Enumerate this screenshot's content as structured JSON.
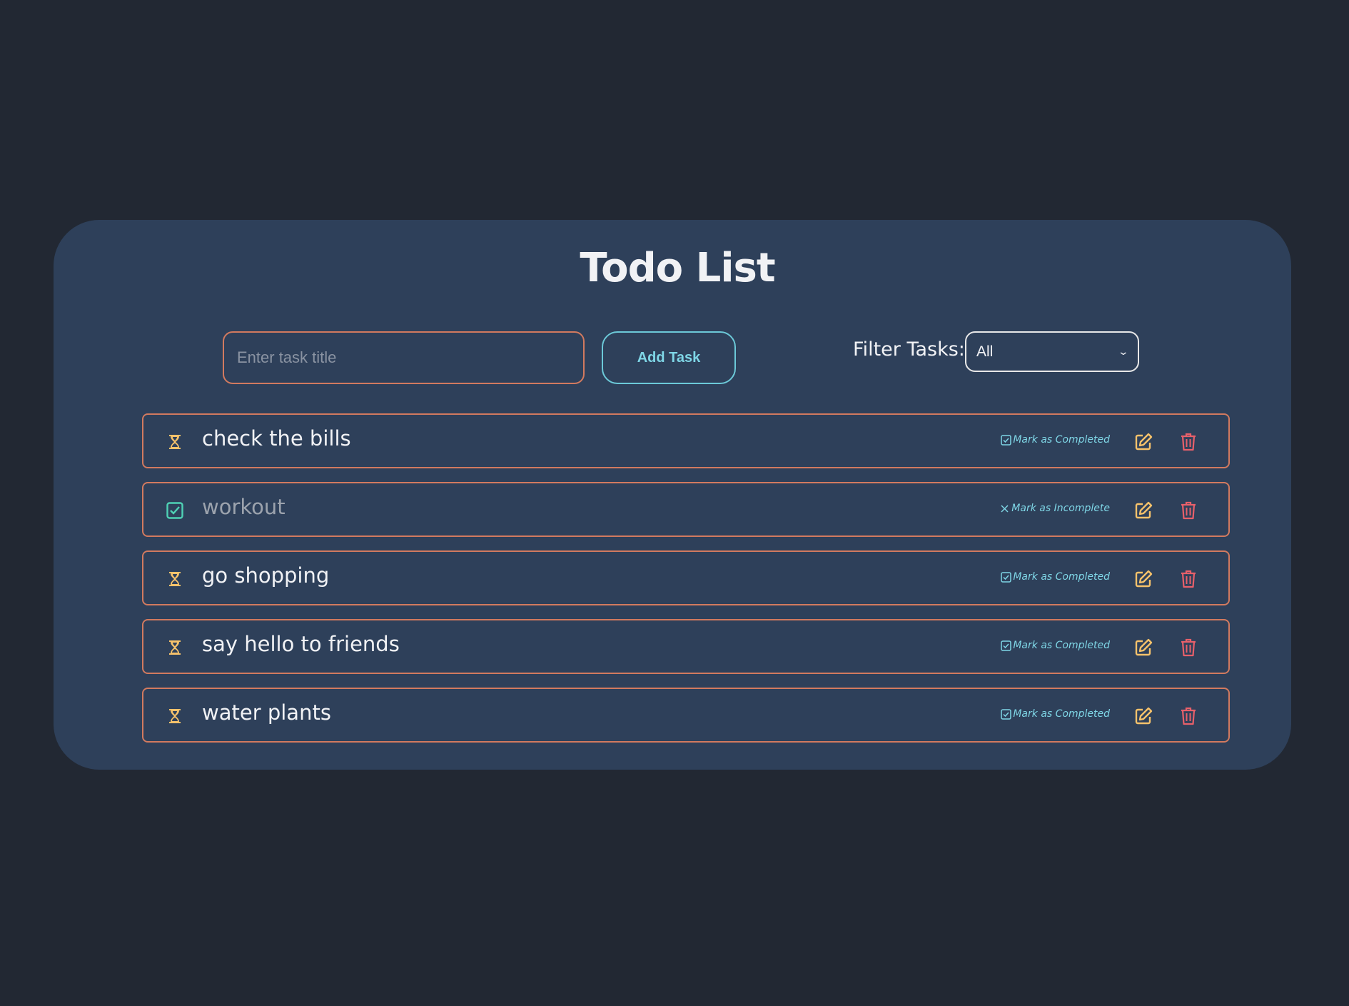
{
  "app": {
    "title": "Todo List"
  },
  "form": {
    "input_placeholder": "Enter task title",
    "input_value": "",
    "add_button_label": "Add Task"
  },
  "filter": {
    "label": "Filter Tasks:",
    "selected": "All"
  },
  "tasks": [
    {
      "title": "check the bills",
      "completed": false,
      "status_icon": "hourglass-icon",
      "toggle_label": "Mark as Completed",
      "toggle_icon": "checkbox-icon"
    },
    {
      "title": "workout",
      "completed": true,
      "status_icon": "checked-box-icon",
      "toggle_label": "Mark as Incomplete",
      "toggle_icon": "x-icon"
    },
    {
      "title": "go shopping",
      "completed": false,
      "status_icon": "hourglass-icon",
      "toggle_label": "Mark as Completed",
      "toggle_icon": "checkbox-icon"
    },
    {
      "title": "say hello to friends",
      "completed": false,
      "status_icon": "hourglass-icon",
      "toggle_label": "Mark as Completed",
      "toggle_icon": "checkbox-icon"
    },
    {
      "title": "water plants",
      "completed": false,
      "status_icon": "hourglass-icon",
      "toggle_label": "Mark as Completed",
      "toggle_icon": "checkbox-icon"
    }
  ],
  "colors": {
    "background": "#222833",
    "card": "#2e405a",
    "task_border": "#d27a5f",
    "accent_cyan": "#7fd6e6",
    "pending_icon": "#f6c26b",
    "edit_icon": "#f6c26b",
    "delete_icon": "#e8606a",
    "completed_icon": "#4fd1b5"
  }
}
